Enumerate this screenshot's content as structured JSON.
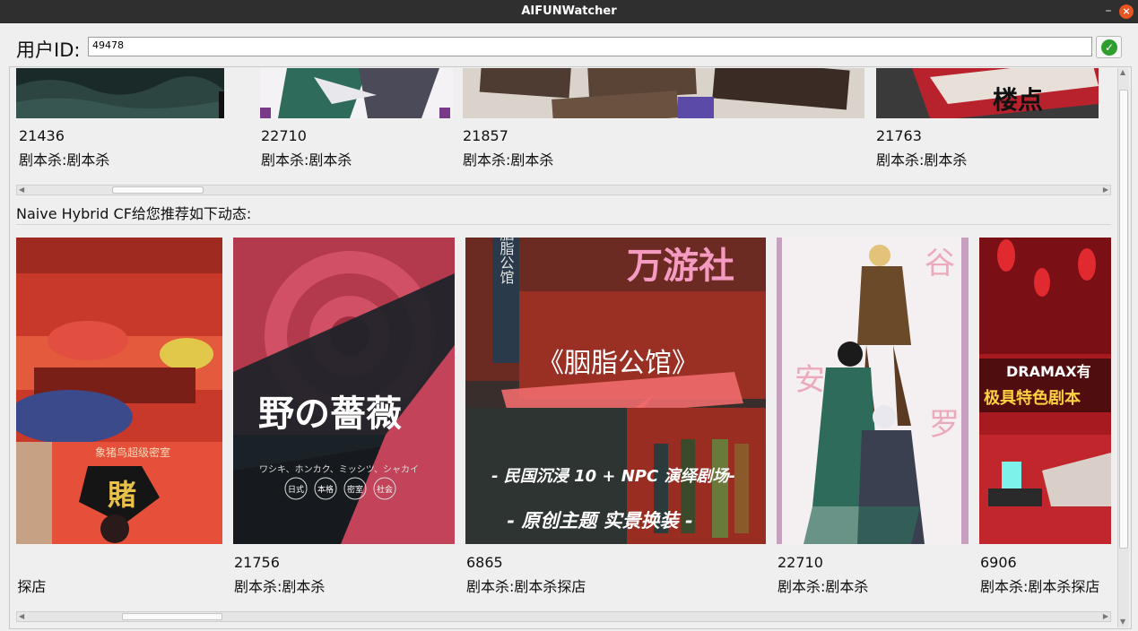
{
  "window": {
    "title": "AIFUNWatcher",
    "minimize_glyph": "–",
    "close_glyph": "×"
  },
  "user": {
    "label": "用户ID:",
    "value": "49478",
    "confirm_icon": "check-circle-icon"
  },
  "top_row": {
    "items": [
      {
        "id": "21436",
        "tag": "剧本杀:剧本杀"
      },
      {
        "id": "22710",
        "tag": "剧本杀:剧本杀"
      },
      {
        "id": "21857",
        "tag": "剧本杀:剧本杀"
      },
      {
        "id": "21763",
        "tag": "剧本杀:剧本杀"
      }
    ],
    "poster_text": {
      "fourth": "楼点"
    }
  },
  "recommend": {
    "title": "Naive Hybrid CF给您推荐如下动态:",
    "items": [
      {
        "id": "",
        "tag": ":探店",
        "poster_text": "象猪鸟超级密室",
        "poster_big": "賭"
      },
      {
        "id": "21756",
        "tag": "剧本杀:剧本杀",
        "poster_title": "野の薔薇",
        "poster_sub": "ワシキ、ホンカク、ミッシツ、シャカイ",
        "poster_badges": [
          "日式",
          "本格",
          "密室",
          "社会"
        ]
      },
      {
        "id": "6865",
        "tag": "剧本杀:剧本杀探店",
        "poster_brand": "万游社",
        "poster_name": "《胭脂公馆》",
        "poster_line1": "- 民国沉浸 10 + NPC 演绎剧场-",
        "poster_line2": "- 原创主题 实景换装 -",
        "poster_sign": "胭脂公馆"
      },
      {
        "id": "22710",
        "tag": "剧本杀:剧本杀"
      },
      {
        "id": "6906",
        "tag": "剧本杀:剧本杀探店",
        "poster_line1": "DRAMAX有",
        "poster_line2": "极具特色剧本"
      }
    ]
  },
  "colors": {
    "titlebar": "#2f2f2f",
    "close": "#e95420",
    "ok": "#2e9e2e"
  }
}
